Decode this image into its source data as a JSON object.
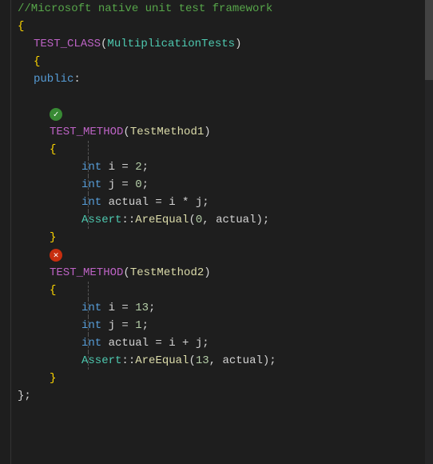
{
  "editor": {
    "background": "#1e1e1e",
    "lines": [
      {
        "id": 1,
        "indent": 0,
        "tokens": [
          {
            "text": "//Microsoft native unit test framework",
            "color": "comment"
          }
        ]
      },
      {
        "id": 2,
        "indent": 0,
        "tokens": [
          {
            "text": "{",
            "color": "brace"
          }
        ]
      },
      {
        "id": 3,
        "indent": 1,
        "tokens": [
          {
            "text": "TEST_CLASS",
            "color": "macro"
          },
          {
            "text": "(",
            "color": "plain"
          },
          {
            "text": "MultiplicationTests",
            "color": "class"
          },
          {
            "text": ")",
            "color": "plain"
          }
        ]
      },
      {
        "id": 4,
        "indent": 1,
        "tokens": [
          {
            "text": "{",
            "color": "brace"
          }
        ]
      },
      {
        "id": 5,
        "indent": 1,
        "tokens": [
          {
            "text": "public",
            "color": "keyword"
          },
          {
            "text": ":",
            "color": "plain"
          }
        ]
      },
      {
        "id": 6,
        "indent": 0,
        "tokens": []
      },
      {
        "id": 7,
        "indent": 2,
        "testIcon": "pass",
        "tokens": []
      },
      {
        "id": 8,
        "indent": 2,
        "tokens": [
          {
            "text": "TEST_METHOD",
            "color": "macro"
          },
          {
            "text": "(",
            "color": "plain"
          },
          {
            "text": "TestMethod1",
            "color": "method"
          },
          {
            "text": ")",
            "color": "plain"
          }
        ]
      },
      {
        "id": 9,
        "indent": 2,
        "tokens": [
          {
            "text": "{",
            "color": "brace"
          }
        ],
        "hasVLine": true
      },
      {
        "id": 10,
        "indent": 4,
        "tokens": [
          {
            "text": "int",
            "color": "keyword"
          },
          {
            "text": " i = ",
            "color": "plain"
          },
          {
            "text": "2",
            "color": "number"
          },
          {
            "text": ";",
            "color": "plain"
          }
        ],
        "hasVLine": true
      },
      {
        "id": 11,
        "indent": 4,
        "tokens": [
          {
            "text": "int",
            "color": "keyword"
          },
          {
            "text": " j = ",
            "color": "plain"
          },
          {
            "text": "0",
            "color": "number"
          },
          {
            "text": ";",
            "color": "plain"
          }
        ],
        "hasVLine": true
      },
      {
        "id": 12,
        "indent": 4,
        "tokens": [
          {
            "text": "int",
            "color": "keyword"
          },
          {
            "text": " actual = i * j;",
            "color": "plain"
          }
        ],
        "hasVLine": true
      },
      {
        "id": 13,
        "indent": 4,
        "tokens": [
          {
            "text": "Assert",
            "color": "class"
          },
          {
            "text": "::",
            "color": "plain"
          },
          {
            "text": "AreEqual",
            "color": "method"
          },
          {
            "text": "(",
            "color": "plain"
          },
          {
            "text": "0",
            "color": "number"
          },
          {
            "text": ", actual);",
            "color": "plain"
          }
        ],
        "hasVLine": true
      },
      {
        "id": 14,
        "indent": 2,
        "tokens": [
          {
            "text": "}",
            "color": "brace"
          }
        ]
      },
      {
        "id": 15,
        "indent": 2,
        "testIcon": "fail",
        "tokens": []
      },
      {
        "id": 16,
        "indent": 2,
        "tokens": [
          {
            "text": "TEST_METHOD",
            "color": "macro"
          },
          {
            "text": "(",
            "color": "plain"
          },
          {
            "text": "TestMethod2",
            "color": "method"
          },
          {
            "text": ")",
            "color": "plain"
          }
        ]
      },
      {
        "id": 17,
        "indent": 2,
        "tokens": [
          {
            "text": "{",
            "color": "brace"
          }
        ],
        "hasVLine": true
      },
      {
        "id": 18,
        "indent": 4,
        "tokens": [
          {
            "text": "int",
            "color": "keyword"
          },
          {
            "text": " i = ",
            "color": "plain"
          },
          {
            "text": "13",
            "color": "number"
          },
          {
            "text": ";",
            "color": "plain"
          }
        ],
        "hasVLine": true
      },
      {
        "id": 19,
        "indent": 4,
        "tokens": [
          {
            "text": "int",
            "color": "keyword"
          },
          {
            "text": " j = ",
            "color": "plain"
          },
          {
            "text": "1",
            "color": "number"
          },
          {
            "text": ";",
            "color": "plain"
          }
        ],
        "hasVLine": true
      },
      {
        "id": 20,
        "indent": 4,
        "tokens": [
          {
            "text": "int",
            "color": "keyword"
          },
          {
            "text": " actual = i + j;",
            "color": "plain"
          }
        ],
        "hasVLine": true
      },
      {
        "id": 21,
        "indent": 4,
        "tokens": [
          {
            "text": "Assert",
            "color": "class"
          },
          {
            "text": "::",
            "color": "plain"
          },
          {
            "text": "AreEqual",
            "color": "method"
          },
          {
            "text": "(",
            "color": "plain"
          },
          {
            "text": "13",
            "color": "number"
          },
          {
            "text": ", actual);",
            "color": "plain"
          }
        ],
        "hasVLine": true
      },
      {
        "id": 22,
        "indent": 2,
        "tokens": [
          {
            "text": "}",
            "color": "brace"
          }
        ]
      },
      {
        "id": 23,
        "indent": 0,
        "tokens": [
          {
            "text": "};",
            "color": "plain"
          }
        ]
      }
    ]
  }
}
